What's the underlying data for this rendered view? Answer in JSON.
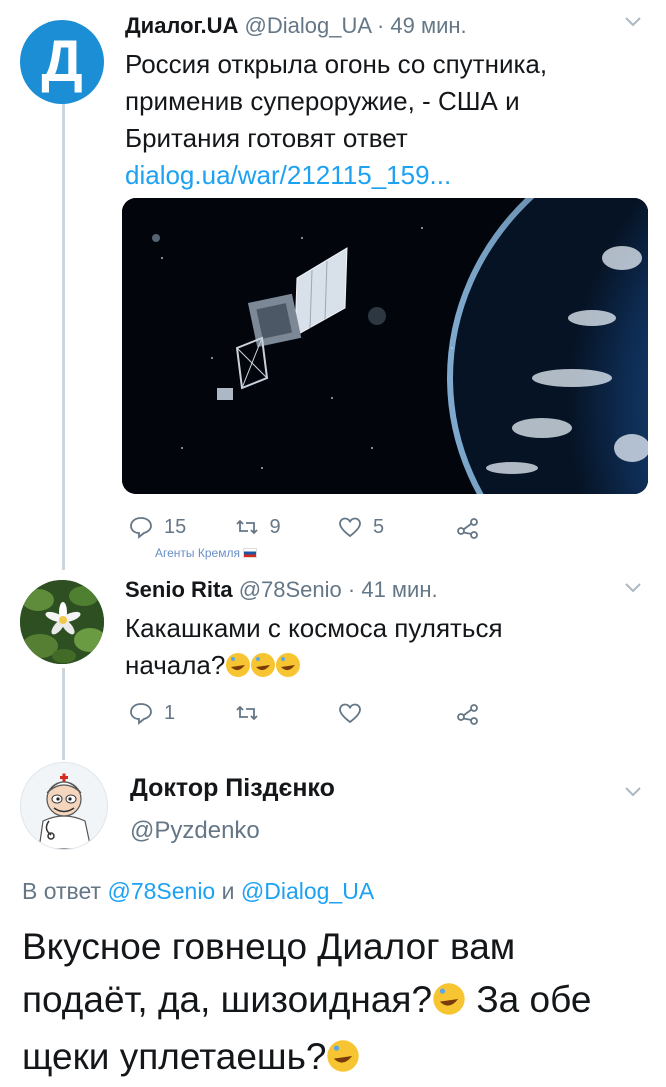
{
  "tweet1": {
    "avatar_letter": "Д",
    "name": "Диалог.UA",
    "handle": "@Dialog_UA",
    "time": "· 49 мин.",
    "text": "Россия открыла огонь со спутника, применив супероружие, - США и Британия готовят ответ",
    "link": "dialog.ua/war/212115_159...",
    "replies": "15",
    "retweets": "9",
    "likes": "5",
    "caption": "Агенты Кремля"
  },
  "tweet2": {
    "name": "Senio Rita",
    "handle": "@78Senio",
    "time": "· 41 мин.",
    "text": "Какашками с космоса пуляться начала?",
    "replies": "1"
  },
  "tweet3": {
    "name": "Доктор Піздєнко",
    "handle": "@Pyzdenko",
    "reply_prefix": "В ответ",
    "reply_to_1": "@78Senio",
    "reply_and": "и",
    "reply_to_2": "@Dialog_UA",
    "text_part1": "Вкусное говнецо Диалог вам подаёт, да, шизоидная?",
    "text_part2": "За обе щеки уплетаешь?"
  },
  "colors": {
    "accent": "#1da1f2",
    "secondary": "#657786",
    "thread": "#cdd6dd"
  }
}
